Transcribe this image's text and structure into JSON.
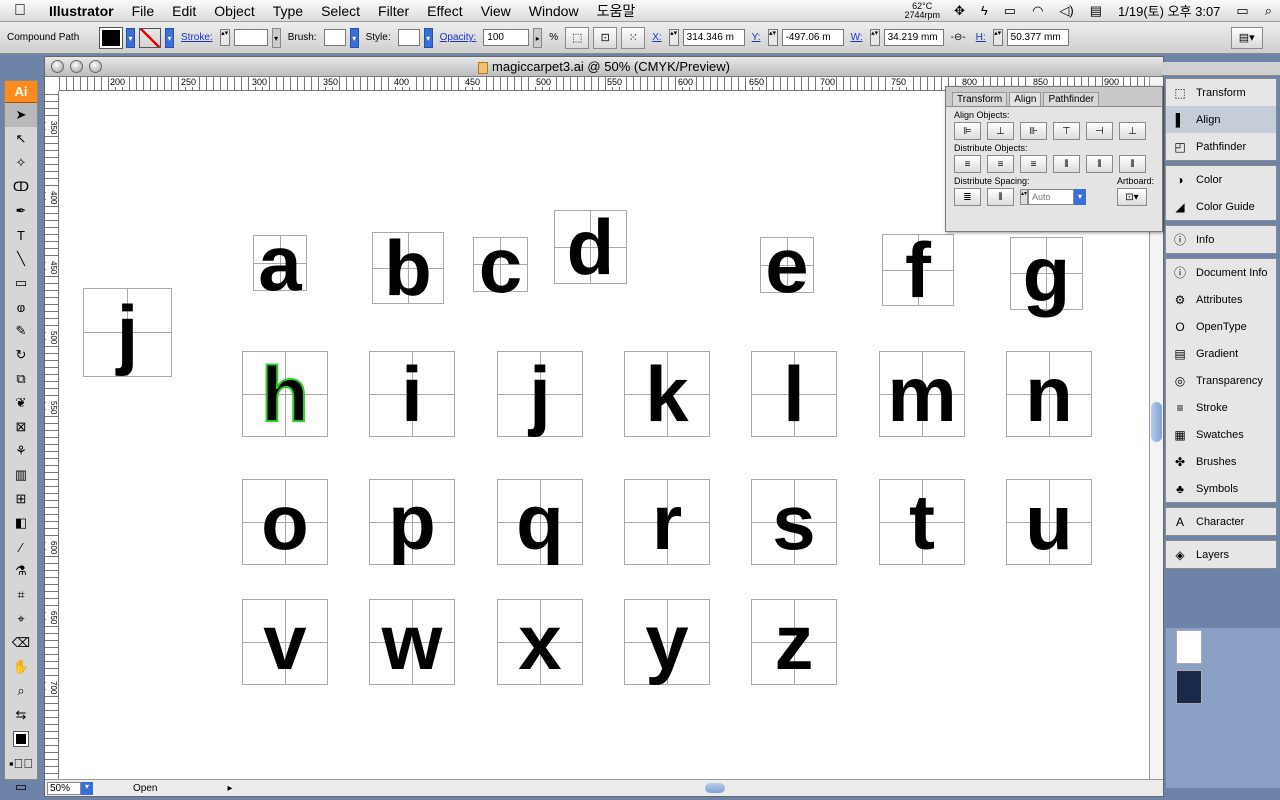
{
  "menubar": {
    "app": "Illustrator",
    "items": [
      "File",
      "Edit",
      "Object",
      "Type",
      "Select",
      "Filter",
      "Effect",
      "View",
      "Window",
      "도움말"
    ],
    "temp": "62°C",
    "rpm": "2744rpm",
    "datetime": "1/19(토) 오후 3:07"
  },
  "control": {
    "selection": "Compound Path",
    "stroke_label": "Stroke:",
    "brush_label": "Brush:",
    "style_label": "Style:",
    "opacity_label": "Opacity:",
    "opacity_value": "100",
    "opacity_unit": "%",
    "x_label": "X:",
    "x_value": "314.346 m",
    "y_label": "Y:",
    "y_value": "-497.06 m",
    "w_label": "W:",
    "w_value": "34.219 mm",
    "h_label": "H:",
    "h_value": "50.377 mm"
  },
  "tools": {
    "logo": "Ai"
  },
  "document": {
    "title": "magiccarpet3.ai @ 50% (CMYK/Preview)",
    "ruler_top": [
      "200",
      "250",
      "300",
      "350",
      "400",
      "450",
      "500",
      "550",
      "600",
      "650",
      "700",
      "750",
      "800",
      "850",
      "900"
    ],
    "ruler_left": [
      "350",
      "400",
      "450",
      "500",
      "550",
      "600",
      "650",
      "700"
    ],
    "zoom": "50%",
    "status": "Open",
    "letters": [
      "j",
      "a",
      "b",
      "c",
      "d",
      "e",
      "f",
      "g",
      "h",
      "i",
      "j",
      "k",
      "l",
      "m",
      "n",
      "o",
      "p",
      "q",
      "r",
      "s",
      "t",
      "u",
      "v",
      "w",
      "x",
      "y",
      "z"
    ]
  },
  "align_panel": {
    "tabs": [
      "Transform",
      "Align",
      "Pathfinder"
    ],
    "align_objects": "Align Objects:",
    "distribute_objects": "Distribute Objects:",
    "distribute_spacing": "Distribute Spacing:",
    "artboard": "Artboard:",
    "auto": "Auto"
  },
  "dock": {
    "group1": [
      "Transform",
      "Align",
      "Pathfinder"
    ],
    "group2": [
      "Color",
      "Color Guide"
    ],
    "group3": [
      "Info"
    ],
    "group4": [
      "Document Info",
      "Attributes",
      "OpenType",
      "Gradient",
      "Transparency",
      "Stroke",
      "Swatches",
      "Brushes",
      "Symbols"
    ],
    "group5": [
      "Character"
    ],
    "group6": [
      "Layers"
    ]
  }
}
